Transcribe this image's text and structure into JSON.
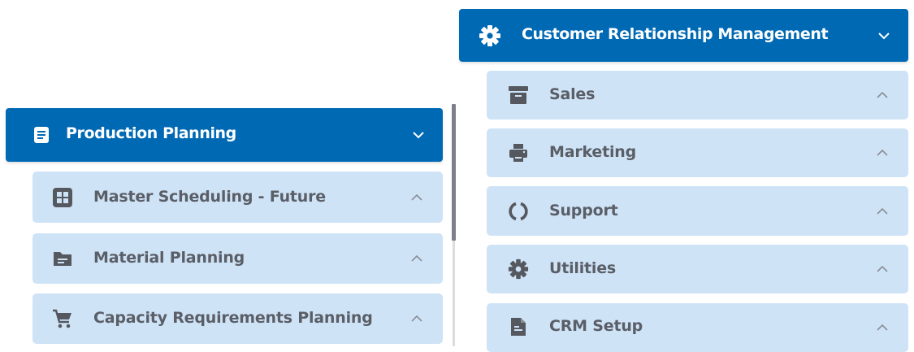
{
  "left_menu": {
    "header": {
      "title": "Production Planning",
      "icon": "document-list-icon",
      "chevron": "chevron-down-icon"
    },
    "items": [
      {
        "label": "Master Scheduling - Future",
        "icon": "grid-icon",
        "chevron": "chevron-up-icon"
      },
      {
        "label": "Material Planning",
        "icon": "folder-icon",
        "chevron": "chevron-up-icon"
      },
      {
        "label": "Capacity Requirements Planning",
        "icon": "cart-icon",
        "chevron": "chevron-up-icon"
      }
    ]
  },
  "right_menu": {
    "header": {
      "title": "Customer Relationship Management",
      "icon": "gear-icon",
      "chevron": "chevron-down-icon"
    },
    "items": [
      {
        "label": "Sales",
        "icon": "archive-box-icon",
        "chevron": "chevron-up-icon"
      },
      {
        "label": "Marketing",
        "icon": "printer-icon",
        "chevron": "chevron-up-icon"
      },
      {
        "label": "Support",
        "icon": "loading-circle-icon",
        "chevron": "chevron-up-icon"
      },
      {
        "label": "Utilities",
        "icon": "gear-icon",
        "chevron": "chevron-up-icon"
      },
      {
        "label": "CRM Setup",
        "icon": "document-icon",
        "chevron": "chevron-up-icon"
      }
    ]
  },
  "colors": {
    "header_bg": "#0069b4",
    "item_bg": "#cfe3f7",
    "item_text": "#5a5e66",
    "icon": "#55585f"
  }
}
